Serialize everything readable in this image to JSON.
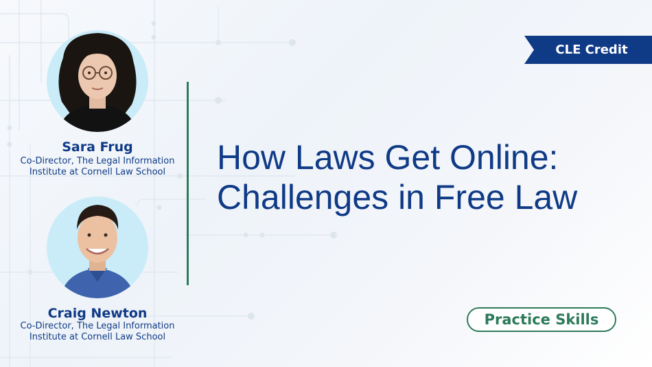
{
  "badge": {
    "label": "CLE Credit"
  },
  "speakers": [
    {
      "name": "Sara Frug",
      "title_line1": "Co-Director, The Legal Information",
      "title_line2": "Institute at Cornell Law School"
    },
    {
      "name": "Craig Newton",
      "title_line1": "Co-Director, The Legal Information",
      "title_line2": "Institute at Cornell Law School"
    }
  ],
  "headline": {
    "line1": "How Laws Get Online:",
    "line2": "Challenges in Free Law"
  },
  "category": {
    "label": "Practice Skills"
  },
  "colors": {
    "navy": "#0f3a86",
    "green": "#2d7a5b",
    "photo_bg": "#c9ecf8"
  }
}
